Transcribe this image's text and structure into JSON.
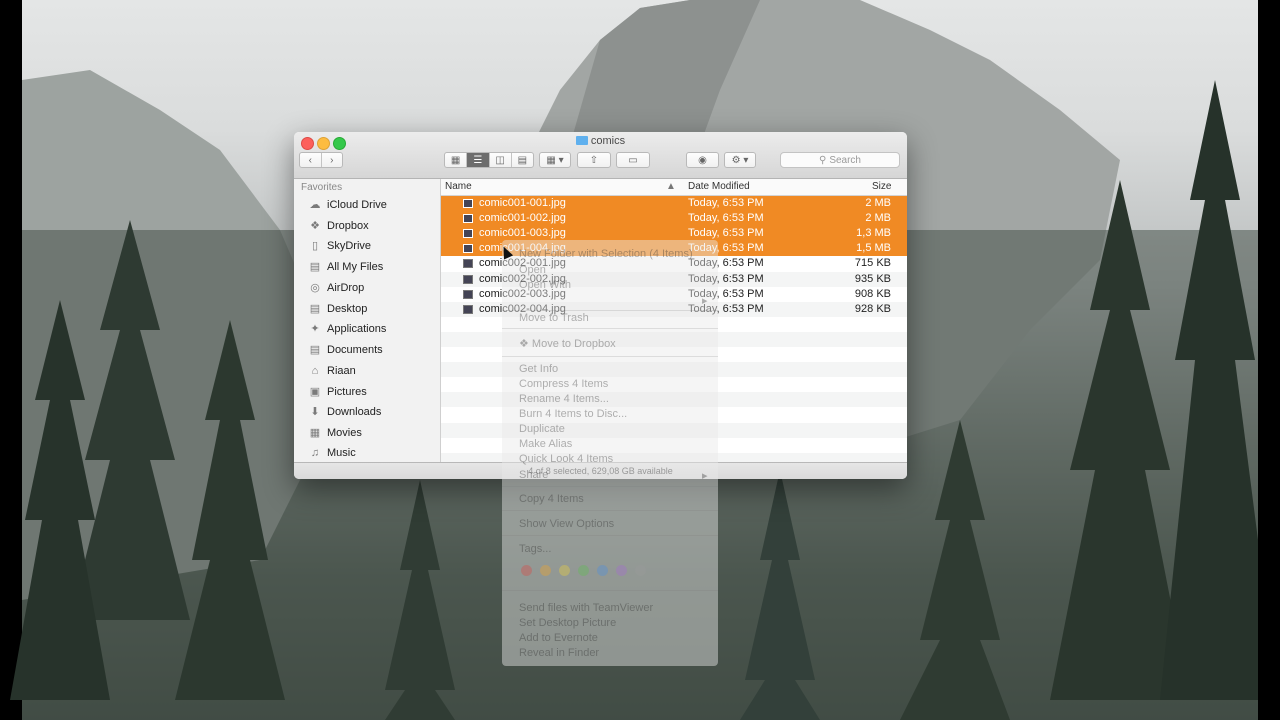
{
  "window": {
    "title": "comics"
  },
  "toolbar": {
    "search_placeholder": "Search"
  },
  "sidebar": {
    "header": "Favorites",
    "items": [
      {
        "label": "iCloud Drive",
        "icon": "cloud-icon"
      },
      {
        "label": "Dropbox",
        "icon": "dropbox-icon"
      },
      {
        "label": "SkyDrive",
        "icon": "folder-icon"
      },
      {
        "label": "All My Files",
        "icon": "all-files-icon"
      },
      {
        "label": "AirDrop",
        "icon": "airdrop-icon"
      },
      {
        "label": "Desktop",
        "icon": "desktop-icon"
      },
      {
        "label": "Applications",
        "icon": "applications-icon"
      },
      {
        "label": "Documents",
        "icon": "documents-icon"
      },
      {
        "label": "Riaan",
        "icon": "home-icon"
      },
      {
        "label": "Pictures",
        "icon": "camera-icon"
      },
      {
        "label": "Downloads",
        "icon": "download-icon"
      },
      {
        "label": "Movies",
        "icon": "film-icon"
      },
      {
        "label": "Music",
        "icon": "music-icon"
      }
    ]
  },
  "list": {
    "columns": {
      "name": "Name",
      "date": "Date Modified",
      "size": "Size"
    },
    "rows": [
      {
        "name": "comic001-001.jpg",
        "date": "Today, 6:53 PM",
        "size": "2 MB",
        "selected": true
      },
      {
        "name": "comic001-002.jpg",
        "date": "Today, 6:53 PM",
        "size": "2 MB",
        "selected": true
      },
      {
        "name": "comic001-003.jpg",
        "date": "Today, 6:53 PM",
        "size": "1,3 MB",
        "selected": true
      },
      {
        "name": "comic001-004.jpg",
        "date": "Today, 6:53 PM",
        "size": "1,5 MB",
        "selected": true
      },
      {
        "name": "comic002-001.jpg",
        "date": "Today, 6:53 PM",
        "size": "715 KB",
        "selected": false
      },
      {
        "name": "comic002-002.jpg",
        "date": "Today, 6:53 PM",
        "size": "935 KB",
        "selected": false
      },
      {
        "name": "comic002-003.jpg",
        "date": "Today, 6:53 PM",
        "size": "908 KB",
        "selected": false
      },
      {
        "name": "comic002-004.jpg",
        "date": "Today, 6:53 PM",
        "size": "928 KB",
        "selected": false
      }
    ]
  },
  "status": "4 of 8 selected, 629,08 GB available",
  "context_menu": {
    "items": [
      "New Folder with Selection (4 Items)",
      "Open",
      "Open With",
      "Move to Trash",
      "Move to Dropbox",
      "Get Info",
      "Compress 4 Items",
      "Rename 4 Items...",
      "Burn 4 Items to Disc...",
      "Duplicate",
      "Make Alias",
      "Quick Look 4 Items",
      "Share",
      "Copy 4 Items",
      "Show View Options",
      "Tags...",
      "Send files with TeamViewer",
      "Set Desktop Picture",
      "Add to Evernote",
      "Reveal in Finder"
    ],
    "tag_colors": [
      "#e0443e",
      "#f5a623",
      "#f2d43a",
      "#5cc04c",
      "#4a90e2",
      "#a66bd3",
      "#9b9b9b"
    ]
  }
}
